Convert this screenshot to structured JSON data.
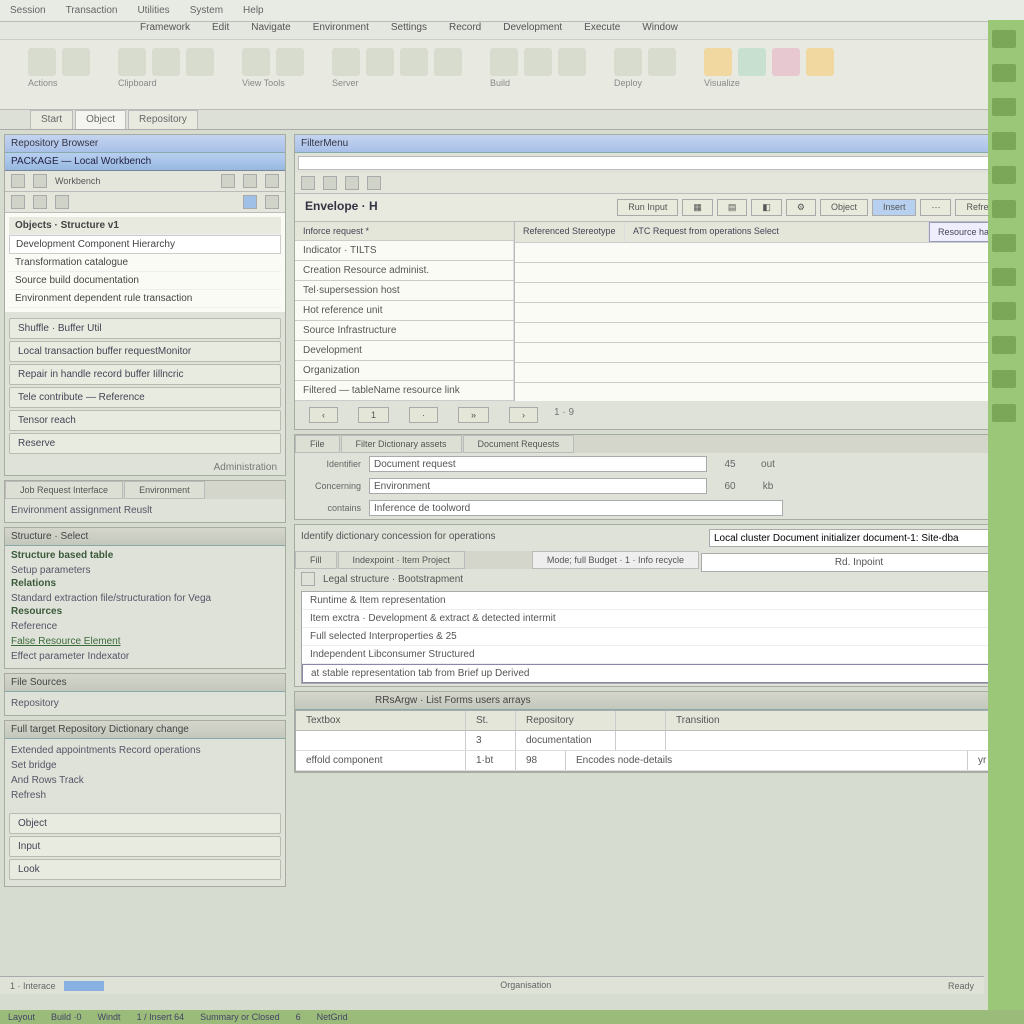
{
  "topmenu": [
    "Session",
    "Transaction",
    "Utilities",
    "System",
    "Help"
  ],
  "menubar": [
    "Framework",
    "Edit",
    "Navigate",
    "Environment",
    "Settings",
    "Record",
    "Development",
    "Execute",
    "Window"
  ],
  "ribbon": [
    {
      "icons": 2,
      "label": "Actions"
    },
    {
      "icons": 3,
      "label": "Clipboard"
    },
    {
      "icons": 2,
      "label": "View Tools"
    },
    {
      "icons": 4,
      "label": "Server"
    },
    {
      "icons": 3,
      "label": "Build"
    },
    {
      "icons": 2,
      "label": "Deploy"
    },
    {
      "icons": 4,
      "label": "Visualize"
    }
  ],
  "tabs": [
    "Start",
    "Object",
    "Repository"
  ],
  "leftPanel": {
    "title": "Repository Browser",
    "subtitle": "PACKAGE — Local Workbench",
    "toolLabel": "Workbench",
    "groupHeader": "Objects · Structure v1",
    "tree": [
      "Development Component Hierarchy",
      "Transformation catalogue",
      "Source build documentation",
      "Environment dependent rule transaction"
    ],
    "nodes": [
      "Shuffle · Buffer Util",
      "Local transaction buffer requestMonitor",
      "Repair in handle record buffer Iillncric",
      "Tele contribute — Reference",
      "Tensor reach",
      "Reserve"
    ],
    "footer": "Administration"
  },
  "accord1": {
    "tabs": [
      "Job Request Interface",
      "Environment"
    ],
    "line": "Environment assignment Reuslt"
  },
  "accord2": {
    "title": "Structure · Select",
    "rows": [
      {
        "t": "Structure based table",
        "d": "Setup parameters"
      },
      {
        "t": "Relations",
        "d": "Standard extraction file/structuration for Vega"
      },
      {
        "t": "Resources",
        "d": "Reference"
      },
      {
        "t": "",
        "d": "False Resource Element"
      },
      {
        "t": "",
        "d": "Effect parameter Indexator"
      }
    ]
  },
  "accord3": {
    "title": "File Sources",
    "line": "Repository"
  },
  "bottomLeft": {
    "title": "Full target Repository Dictionary change",
    "lines": [
      "Extended appointments Record operations",
      "Set bridge",
      "And Rows Track",
      "Refresh"
    ],
    "cats": [
      "Object",
      "Input",
      "Look"
    ]
  },
  "mainPanel": {
    "header": "FilterMenu",
    "title": "Envelope · H",
    "buttons": [
      "Run Input",
      "",
      "",
      "",
      "",
      "Object",
      "Insert",
      "",
      "Refresh"
    ],
    "colA": [
      "Inforce request *",
      "Indicator · TILTS",
      "Creation Resource administ.",
      "Tel·supersession host",
      "Hot reference unit",
      "Source Infrastructure",
      "Development",
      "Organization",
      "Filtered — tableName resource link"
    ],
    "headerRight": {
      "l": "Referenced Stereotype",
      "r": "ATC Request from operations Select",
      "btn": "Resource handler"
    },
    "pager": [
      "‹",
      "1",
      "·",
      "»",
      "›",
      "1 · 9"
    ]
  },
  "midForm": {
    "tabs": [
      "File",
      "Filter Dictionary assets",
      "Document Requests"
    ],
    "rows": [
      {
        "k": "Identifier",
        "v": "Document request",
        "n": "45",
        "u": "out"
      },
      {
        "k": "Concerning",
        "v": "Environment",
        "n": "60",
        "u": "kb"
      },
      {
        "k": "contains",
        "v": "Inference de toolword",
        "n": "",
        "u": ""
      }
    ]
  },
  "lowerSearch": {
    "label": "Identify dictionary concession for operations",
    "placeholder": "Local cluster Document initializer document-1: Site-dba",
    "tabs": [
      "Fill",
      "Indexpoint · Item Project"
    ],
    "rightInfo": "Mode; full Budget · 1 · Info recycle",
    "row2label": "Legal structure · Bootstrapment",
    "row2btn": "Rd. Inpoint",
    "list": [
      "Runtime & Item representation",
      "Item exctra · Development & extract & detected intermit",
      "Full selected Interproperties & 25",
      "Independent Libconsumer Structured",
      "at stable representation tab from Brief up Derived"
    ]
  },
  "resultsPanel": {
    "title": "RRsArgw · List Forms users arrays",
    "cols": [
      "Textbox",
      "St.",
      "Repository",
      "",
      "Transition"
    ],
    "rows": [
      [
        "",
        "3",
        "documentation",
        "",
        ""
      ],
      [
        "effold component",
        "1·bt",
        "98",
        "Encodes node-details",
        "yr"
      ]
    ]
  },
  "statusbar": {
    "l": "1 · Interace",
    "c": "Organisation",
    "r": "Ready"
  },
  "taskbar": [
    "Layout",
    "Build ·0",
    "Windt",
    "1 / Insert 64",
    "Summary or Closed",
    "6",
    "NetGrid"
  ]
}
